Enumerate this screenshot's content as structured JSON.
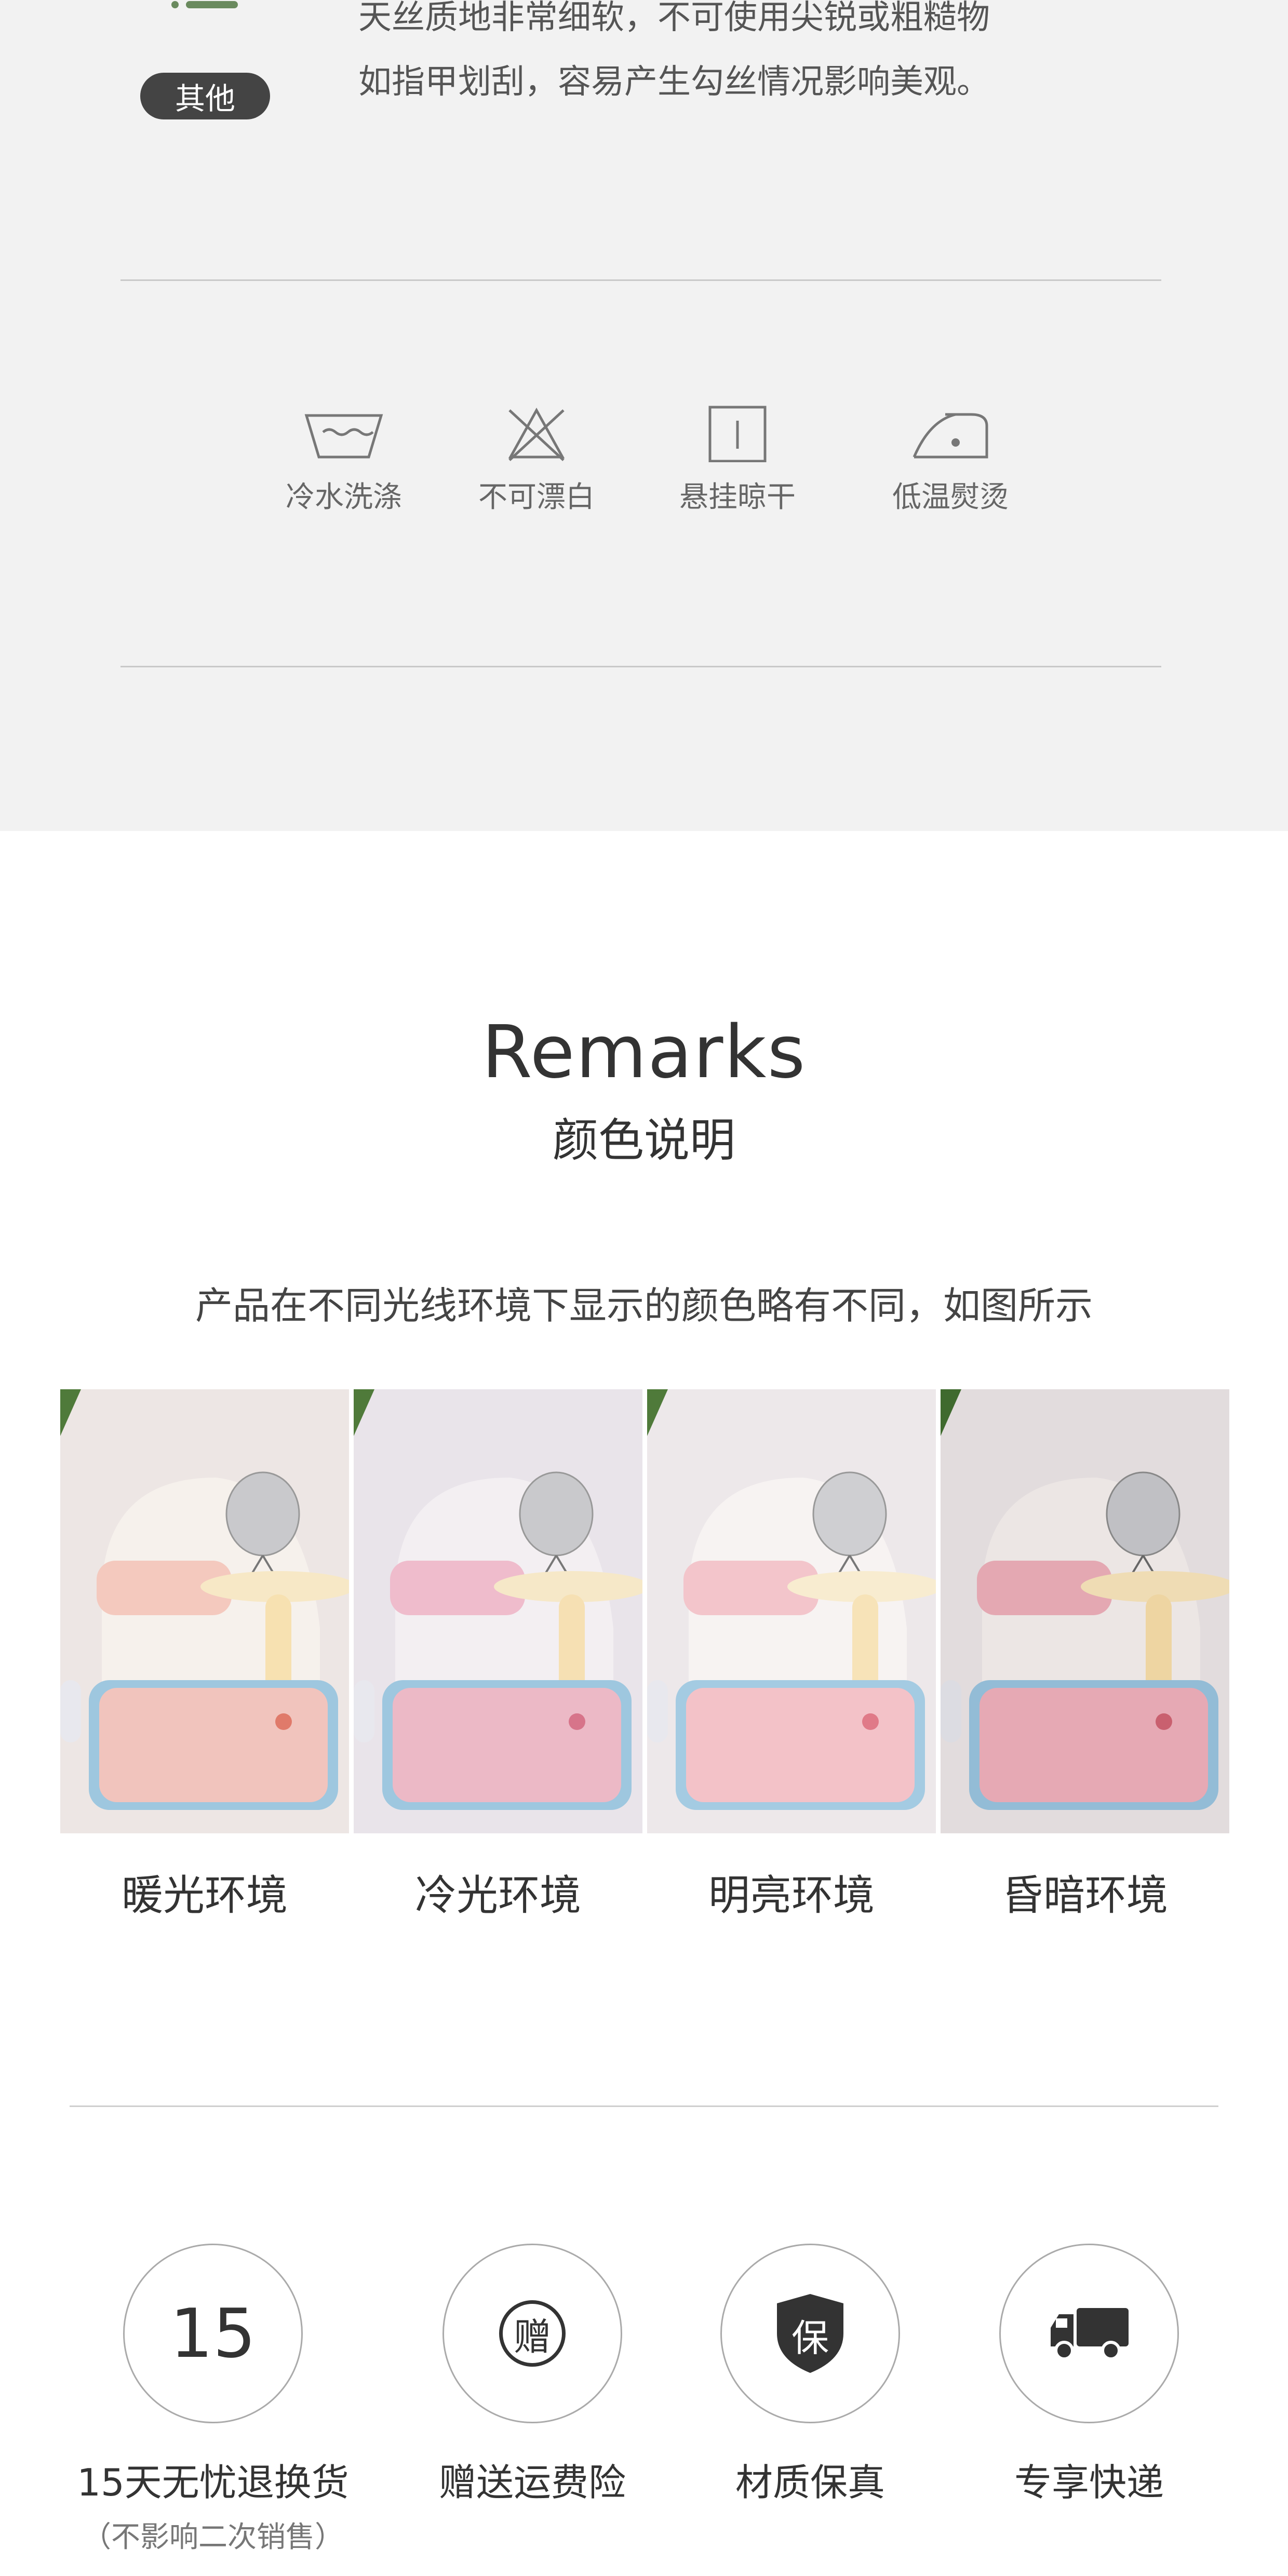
{
  "care_section": {
    "tag": "其他",
    "note_lines": [
      "天丝质地非常细软，不可使用尖锐或粗糙物",
      "如指甲划刮，容易产生勾丝情况影响美观。"
    ],
    "icons": [
      {
        "icon": "wash-basin-icon",
        "label": "冷水洗涤"
      },
      {
        "icon": "no-bleach-icon",
        "label": "不可漂白"
      },
      {
        "icon": "hang-dry-icon",
        "label": "悬挂晾干"
      },
      {
        "icon": "low-temp-iron-icon",
        "label": "低温熨烫"
      }
    ]
  },
  "remarks": {
    "title_en": "Remarks",
    "title_cn": "颜色说明",
    "description": "产品在不同光线环境下显示的颜色略有不同，如图所示",
    "photos": [
      {
        "label": "暖光环境",
        "tint": "#f1c4bd"
      },
      {
        "label": "冷光环境",
        "tint": "#ecb9c6"
      },
      {
        "label": "明亮环境",
        "tint": "#f3c2c8"
      },
      {
        "label": "昏暗环境",
        "tint": "#e6a9b4"
      }
    ]
  },
  "services": [
    {
      "icon": "number-15-icon",
      "icon_text": "15",
      "title": "15天无忧退换货",
      "sub": "（不影响二次销售）"
    },
    {
      "icon": "gift-badge-icon",
      "icon_text": "赠",
      "title": "赠送运费险",
      "sub": ""
    },
    {
      "icon": "shield-icon",
      "icon_text": "保",
      "title": "材质保真",
      "sub": ""
    },
    {
      "icon": "truck-icon",
      "icon_text": "",
      "title": "专享快递",
      "sub": ""
    }
  ]
}
